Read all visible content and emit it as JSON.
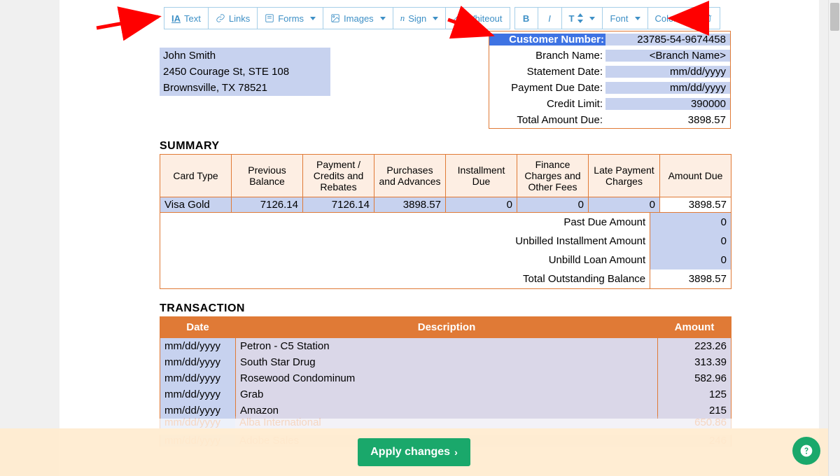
{
  "toolbar": {
    "text": "Text",
    "links": "Links",
    "forms": "Forms",
    "images": "Images",
    "sign": "Sign",
    "whiteout": "Whiteout",
    "bold": "B",
    "italic": "I",
    "textsize": "T",
    "font": "Font",
    "color": "Color"
  },
  "address": {
    "line1": "John Smith",
    "line2": "2450 Courage St, STE 108",
    "line3": "Brownsville, TX 78521"
  },
  "info": {
    "customer_number_label": "Customer Number:",
    "customer_number": "23785-54-9674458",
    "branch_name_label": "Branch Name:",
    "branch_name": "<Branch Name>",
    "statement_date_label": "Statement Date:",
    "statement_date": "mm/dd/yyyy",
    "payment_due_label": "Payment Due Date:",
    "payment_due": "mm/dd/yyyy",
    "credit_limit_label": "Credit Limit:",
    "credit_limit": "390000",
    "total_due_label": "Total Amount Due:",
    "total_due": "3898.57"
  },
  "summary": {
    "title": "SUMMARY",
    "headers": {
      "card_type": "Card Type",
      "prev_balance": "Previous Balance",
      "payment_credits": "Payment / Credits and Rebates",
      "purchases": "Purchases and Advances",
      "installment": "Installment Due",
      "finance": "Finance Charges and Other Fees",
      "late": "Late Payment Charges",
      "amount_due": "Amount Due"
    },
    "row": {
      "card_type": "Visa Gold",
      "prev_balance": "7126.14",
      "payment_credits": "7126.14",
      "purchases": "3898.57",
      "installment": "0",
      "finance": "0",
      "late": "0",
      "amount_due": "3898.57"
    },
    "extras": {
      "past_due_label": "Past Due Amount",
      "past_due": "0",
      "unbilled_inst_label": "Unbilled Installment Amount",
      "unbilled_inst": "0",
      "unbilled_loan_label": "Unbilld Loan Amount",
      "unbilled_loan": "0",
      "total_outstanding_label": "Total Outstanding Balance",
      "total_outstanding": "3898.57"
    }
  },
  "transactions": {
    "title": "TRANSACTION",
    "headers": {
      "date": "Date",
      "description": "Description",
      "amount": "Amount"
    },
    "rows": [
      {
        "date": "mm/dd/yyyy",
        "desc": "Petron - C5 Station",
        "amt": "223.26"
      },
      {
        "date": "mm/dd/yyyy",
        "desc": "South Star Drug",
        "amt": "313.39"
      },
      {
        "date": "mm/dd/yyyy",
        "desc": "Rosewood Condominum",
        "amt": "582.96"
      },
      {
        "date": "mm/dd/yyyy",
        "desc": "Grab",
        "amt": "125"
      },
      {
        "date": "mm/dd/yyyy",
        "desc": "Amazon",
        "amt": "215"
      }
    ],
    "faded_rows": [
      {
        "date": "mm/dd/yyyy",
        "desc": "Alba International",
        "amt": "650.86"
      },
      {
        "date": "mm/dd/yyyy",
        "desc": "Adobe Sales",
        "amt": "246"
      }
    ]
  },
  "footer": {
    "apply": "Apply changes"
  }
}
